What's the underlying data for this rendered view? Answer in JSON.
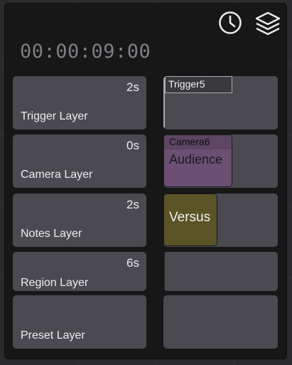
{
  "timecode": "00:00:09:00",
  "header_icons": [
    "clock-icon",
    "layers-icon"
  ],
  "colors": {
    "panel_bg": "#171718",
    "button_bg": "#4b4a51",
    "camera_clip": "#6c4f72",
    "notes_clip": "#5a5426"
  },
  "layers": [
    {
      "name": "Trigger Layer",
      "duration": "2s"
    },
    {
      "name": "Camera Layer",
      "duration": "0s"
    },
    {
      "name": "Notes Layer",
      "duration": "2s"
    },
    {
      "name": "Region Layer",
      "duration": "6s"
    },
    {
      "name": "Preset Layer",
      "duration": ""
    }
  ],
  "clips": {
    "trigger": {
      "label": "Trigger5"
    },
    "camera": {
      "label": "Camera6",
      "text": "Audience"
    },
    "notes": {
      "text": "Versus"
    }
  }
}
